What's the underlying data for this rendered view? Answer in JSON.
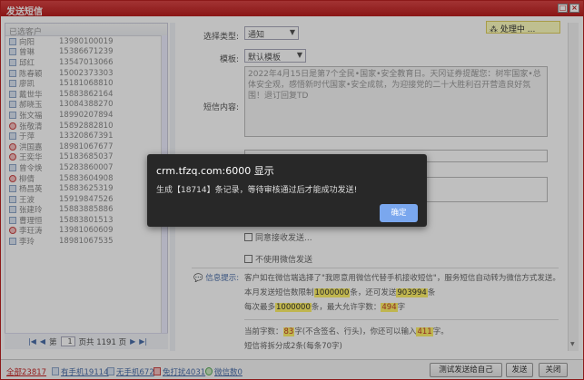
{
  "window": {
    "title": "发送短信",
    "minimize": "□",
    "close": "×"
  },
  "left": {
    "header": "已选客户",
    "contacts": [
      {
        "name": "向阳",
        "phone": "13980100019",
        "icon": "person-icon"
      },
      {
        "name": "曾琳",
        "phone": "15386671239",
        "icon": "person-icon"
      },
      {
        "name": "邱红",
        "phone": "13547013066",
        "icon": "person-icon"
      },
      {
        "name": "陈春颖",
        "phone": "15002373303",
        "icon": "person-icon"
      },
      {
        "name": "廖凯",
        "phone": "15181068810",
        "icon": "person-icon"
      },
      {
        "name": "戴世华",
        "phone": "15883862164",
        "icon": "person-icon"
      },
      {
        "name": "郝晓玉",
        "phone": "13084388270",
        "icon": "person-icon"
      },
      {
        "name": "张文福",
        "phone": "18990207894",
        "icon": "person-icon"
      },
      {
        "name": "张敬清",
        "phone": "15892882810",
        "icon": "no-phone-icon"
      },
      {
        "name": "于萍",
        "phone": "13320867391",
        "icon": "person-icon"
      },
      {
        "name": "洪国嘉",
        "phone": "18981067677",
        "icon": "no-phone-icon"
      },
      {
        "name": "王奕华",
        "phone": "15183685037",
        "icon": "no-phone-icon"
      },
      {
        "name": "曾令焕",
        "phone": "15283860007",
        "icon": "person-icon"
      },
      {
        "name": "柳倩",
        "phone": "15883604908",
        "icon": "no-phone-icon"
      },
      {
        "name": "杨昌英",
        "phone": "15883625319",
        "icon": "person-icon"
      },
      {
        "name": "王波",
        "phone": "15919847526",
        "icon": "person-icon"
      },
      {
        "name": "张建玲",
        "phone": "15883885886",
        "icon": "person-icon"
      },
      {
        "name": "曹理恒",
        "phone": "15883801513",
        "icon": "person-icon"
      },
      {
        "name": "李玨涛",
        "phone": "13981060609",
        "icon": "no-phone-icon"
      },
      {
        "name": "李玲",
        "phone": "18981067535",
        "icon": "person-icon"
      }
    ],
    "pager": {
      "first": "|◀",
      "prev": "◀",
      "page_prefix": "第",
      "page_value": "1",
      "page_suffix": "页共 1191 页",
      "next": "▶",
      "last": "▶|"
    }
  },
  "form": {
    "type_label": "选择类型:",
    "type_value": "通知",
    "template_label": "模板:",
    "template_value": "默认模板",
    "content_label": "短信内容:",
    "content_text": "2022年4月15日是第7个全民•国家•安全教育日。天冈证券提醒您：树牢国家•总体安全观，感悟新时代国家•安全成就，为迎接党的二十大胜利召开营造良好氛围！退订回复TD",
    "opt_no_wechat": "不使用微信发送",
    "opt_partial": "同意接收发送...",
    "info_label": "信息提示:",
    "info_line1": "客户如在微信端选择了\"我愿意用微信代替手机接收短信\"，服务短信自动转为微信方式发送。",
    "info_line2_pre": "本月发送短信数限制",
    "info_line2_limit": "1000000",
    "info_line2_mid": "条，还可发送",
    "info_line2_remain": "903994",
    "info_line2_post": "条",
    "info_line3_pre": "每次最多",
    "info_line3_max": "1000000",
    "info_line3_mid": "条，最大允许字数：",
    "info_line3_chars": "494",
    "info_line3_post": "字",
    "count_pre": "当前字数：",
    "count_value": "83",
    "count_mid": "字(不含签名、行头)，你还可以输入",
    "count_remain": "411",
    "count_post": "字。",
    "split_text": "短信将拆分成2条(每条70字)"
  },
  "processing": "处理中 ...",
  "bottom": {
    "all_label": "全部23817",
    "has_phone": "有手机19114",
    "no_phone": "无手机672",
    "no_disturb": "免打扰4031",
    "wechat": "微信数0",
    "test_button": "测试发送给自己",
    "send_button": "发送",
    "close_button": "关闭"
  },
  "dialog": {
    "title": "crm.tfzq.com:6000 显示",
    "message": "生成【18714】条记录，等待审核通过后才能成功发送!",
    "ok_button": "确定"
  },
  "colors": {
    "title_bar": "#c62828",
    "highlight": "#fff26a",
    "dialog_bg": "#282828",
    "ok_button": "#7aa7ee"
  }
}
